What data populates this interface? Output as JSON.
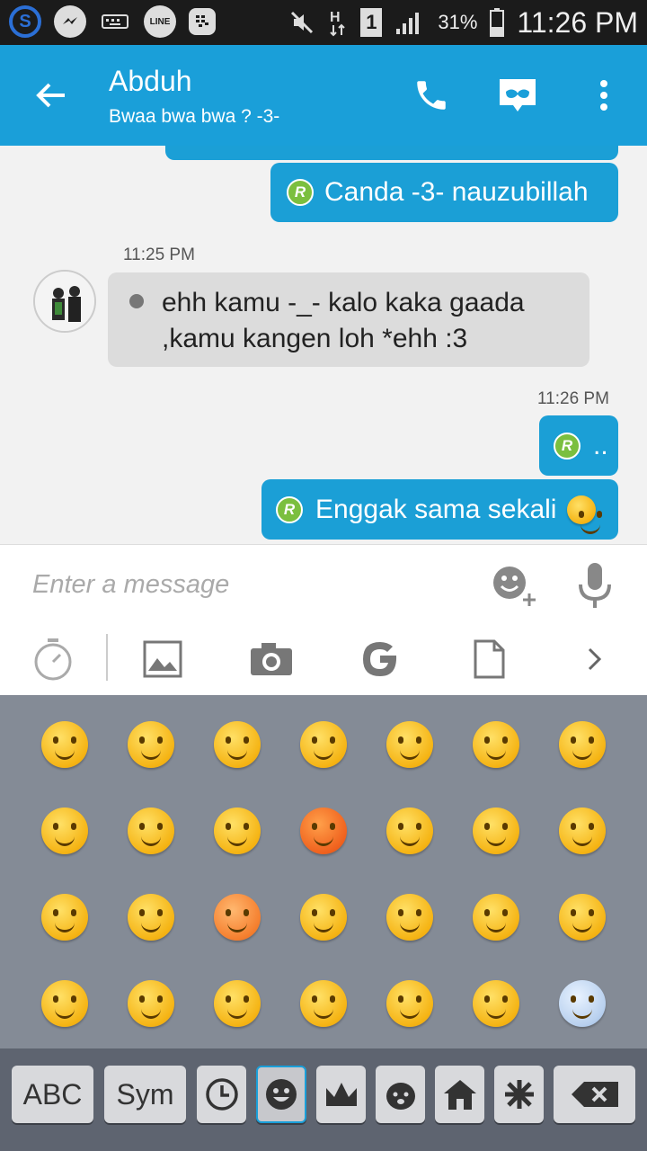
{
  "status": {
    "battery": "31%",
    "time": "11:26 PM",
    "sim": "1"
  },
  "header": {
    "title": "Abduh",
    "subtitle": "Bwaa bwa bwa ? -3-"
  },
  "messages": {
    "m1": {
      "badge": "R",
      "text": "Canda -3- nauzubillah"
    },
    "ts1": "11:25 PM",
    "m2": {
      "line1": "ehh kamu -_- kalo kaka gaada",
      "line2": ",kamu kangen loh *ehh :3"
    },
    "ts2": "11:26 PM",
    "m3": {
      "badge": "R",
      "text": ".."
    },
    "m4": {
      "badge": "R",
      "text": "Enggak sama sekali"
    }
  },
  "input": {
    "placeholder": "Enter a message"
  },
  "keyboard": {
    "abc": "ABC",
    "sym": "Sym"
  },
  "colors": {
    "accent": "#1a9fd9",
    "bubble_out": "#1b9fd6",
    "bubble_in": "#dcdcdc",
    "keyboard_bg": "#848b96"
  }
}
